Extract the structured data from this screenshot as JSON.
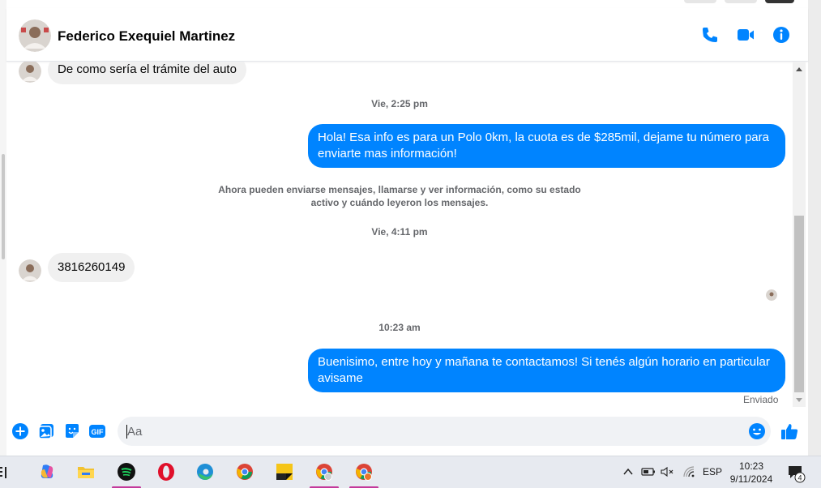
{
  "header": {
    "contact_name": "Federico Exequiel Martinez",
    "icons": [
      "phone-icon",
      "video-icon",
      "info-icon"
    ]
  },
  "messages": {
    "incoming_1": "De como sería el trámite del auto",
    "timestamp_1": "Vie, 2:25 pm",
    "outgoing_1": "Hola! Esa info es para un Polo 0km, la cuota es de $285mil, dejame tu número para enviarte mas información!",
    "notice_line_1": "Ahora pueden enviarse mensajes, llamarse y ver información, como su estado",
    "notice_line_2": "activo y cuándo leyeron los mensajes.",
    "timestamp_2": "Vie, 4:11 pm",
    "incoming_2": "3816260149",
    "timestamp_3": "10:23 am",
    "outgoing_2": "Buenisimo, entre hoy y mañana te contactamos! Si tenés algún horario en particular avisame",
    "status": "Enviado"
  },
  "composer": {
    "placeholder": "Aa",
    "icons": [
      "add-icon",
      "photo-icon",
      "sticker-icon",
      "gif-icon",
      "emoji-icon",
      "like-icon"
    ],
    "gif_label": "GIF"
  },
  "taskbar": {
    "apps": [
      "copilot-icon",
      "file-explorer-icon",
      "spotify-icon",
      "opera-icon",
      "edge-icon",
      "chrome-icon",
      "sticky-notes-icon",
      "chrome-profile-icon",
      "chrome-profile-2-icon"
    ],
    "language": "ESP",
    "time": "10:23",
    "date": "9/11/2024",
    "notification_count": "4"
  },
  "colors": {
    "accent": "#0084ff",
    "incoming_bubble": "#f0f0f0",
    "text_secondary": "#65676b"
  }
}
